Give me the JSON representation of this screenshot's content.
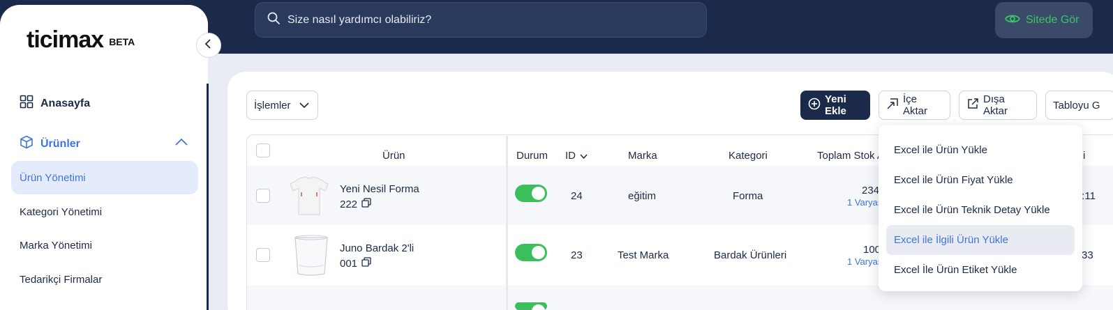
{
  "search": {
    "placeholder": "Size nasıl yardımcı olabiliriz?"
  },
  "header": {
    "view_site_label": "Sitede Gör"
  },
  "brand": {
    "logo": "ticimax",
    "badge": "BETA"
  },
  "sidebar": {
    "home_label": "Anasayfa",
    "products_label": "Ürünler",
    "items": [
      {
        "label": "Ürün Yönetimi"
      },
      {
        "label": "Kategori Yönetimi"
      },
      {
        "label": "Marka Yönetimi"
      },
      {
        "label": "Tedarikçi Firmalar"
      }
    ]
  },
  "toolbar": {
    "actions_label": "İşlemler",
    "new_label": "Yeni Ekle",
    "import_label": "İçe Aktar",
    "export_label": "Dışa Aktar",
    "table_label": "Tabloyu G"
  },
  "table": {
    "columns": {
      "product": "Ürün",
      "status": "Durum",
      "id": "ID",
      "brand": "Marka",
      "category": "Kategori",
      "stock": "Toplam Stok A",
      "extra": "i"
    },
    "rows": [
      {
        "name": "Yeni Nesil Forma",
        "code": "222",
        "id": "24",
        "brand": "eğitim",
        "category": "Forma",
        "stock": "234",
        "variant": "1 Varyas",
        "extra": "::11"
      },
      {
        "name": "Juno Bardak 2'li",
        "code": "001",
        "id": "23",
        "brand": "Test Marka",
        "category": "Bardak Ürünleri",
        "stock": "100",
        "variant": "1 Varyas",
        "extra": "33"
      }
    ]
  },
  "import_menu": {
    "items": [
      "Excel ile Ürün Yükle",
      "Excel ile Ürün Fiyat Yükle",
      "Excel ile Ürün Teknik Detay Yükle",
      "Excel ile İlgili Ürün Yükle",
      "Excel İle Ürün Etiket Yükle"
    ]
  },
  "colors": {
    "navy": "#1b2a4a",
    "accent": "#3f74e0",
    "success": "#3bbf5c"
  }
}
